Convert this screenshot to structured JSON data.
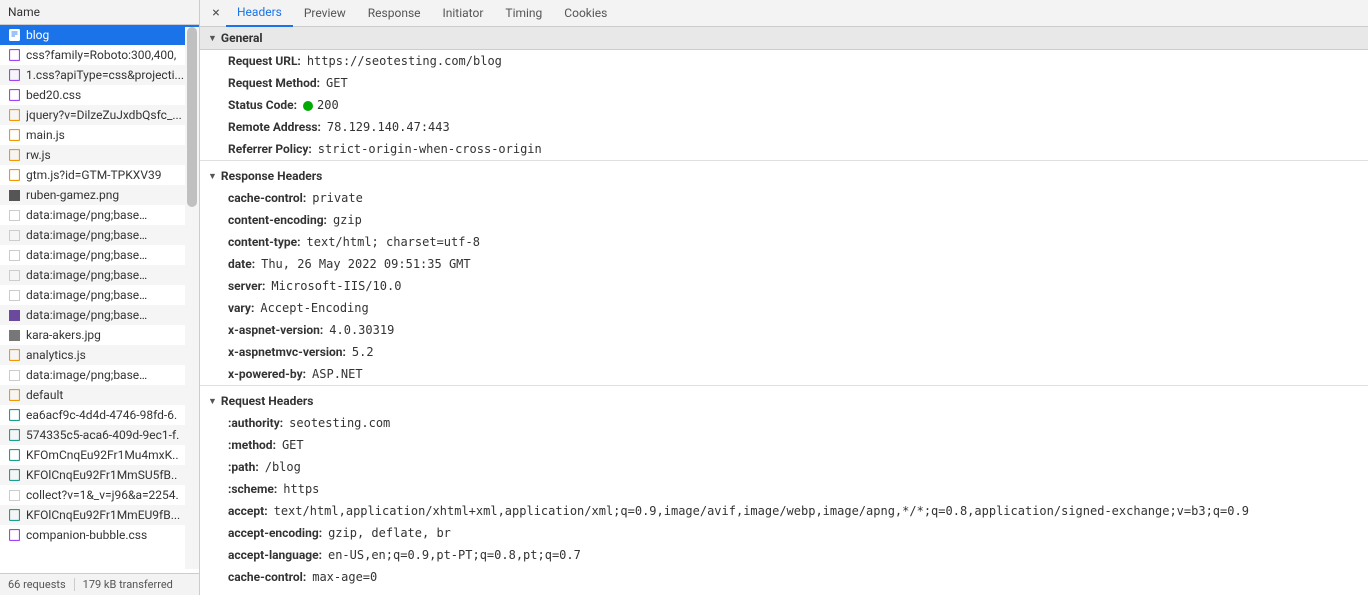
{
  "sidebar": {
    "header": "Name",
    "requests": [
      {
        "label": "blog",
        "iconColor": "#4285f4",
        "shape": "doc",
        "selected": true
      },
      {
        "label": "css?family=Roboto:300,400,",
        "iconColor": "#a142f4",
        "shape": "css"
      },
      {
        "label": "1.css?apiType=css&projecti...",
        "iconColor": "#a142f4",
        "shape": "css"
      },
      {
        "label": "bed20.css",
        "iconColor": "#a142f4",
        "shape": "css"
      },
      {
        "label": "jquery?v=DilzeZuJxdbQsfc_...",
        "iconColor": "#f29900",
        "shape": "js"
      },
      {
        "label": "main.js",
        "iconColor": "#f29900",
        "shape": "js"
      },
      {
        "label": "rw.js",
        "iconColor": "#f29900",
        "shape": "js"
      },
      {
        "label": "gtm.js?id=GTM-TPKXV39",
        "iconColor": "#f29900",
        "shape": "js"
      },
      {
        "label": "ruben-gamez.png",
        "iconColor": "#555",
        "shape": "img-dark"
      },
      {
        "label": "data:image/png;base…",
        "iconColor": "#ccc",
        "shape": "img"
      },
      {
        "label": "data:image/png;base…",
        "iconColor": "#ccc",
        "shape": "img"
      },
      {
        "label": "data:image/png;base…",
        "iconColor": "#ccc",
        "shape": "img"
      },
      {
        "label": "data:image/png;base…",
        "iconColor": "#ccc",
        "shape": "img"
      },
      {
        "label": "data:image/png;base…",
        "iconColor": "#ccc",
        "shape": "img"
      },
      {
        "label": "data:image/png;base…",
        "iconColor": "#6b4a9e",
        "shape": "img-dark"
      },
      {
        "label": "kara-akers.jpg",
        "iconColor": "#777",
        "shape": "img-dark"
      },
      {
        "label": "analytics.js",
        "iconColor": "#f29900",
        "shape": "js"
      },
      {
        "label": "data:image/png;base…",
        "iconColor": "#ccc",
        "shape": "img"
      },
      {
        "label": "default",
        "iconColor": "#f29900",
        "shape": "js"
      },
      {
        "label": "ea6acf9c-4d4d-4746-98fd-6.",
        "iconColor": "#1a9e8f",
        "shape": "font"
      },
      {
        "label": "574335c5-aca6-409d-9ec1-f.",
        "iconColor": "#1a9e8f",
        "shape": "font"
      },
      {
        "label": "KFOmCnqEu92Fr1Mu4mxK..",
        "iconColor": "#1a9e8f",
        "shape": "font"
      },
      {
        "label": "KFOlCnqEu92Fr1MmSU5fB..",
        "iconColor": "#1a9e8f",
        "shape": "font"
      },
      {
        "label": "collect?v=1&_v=j96&a=2254.",
        "iconColor": "#ccc",
        "shape": "img"
      },
      {
        "label": "KFOlCnqEu92Fr1MmEU9fB...",
        "iconColor": "#1a9e8f",
        "shape": "font"
      },
      {
        "label": "companion-bubble.css",
        "iconColor": "#a142f4",
        "shape": "css"
      }
    ],
    "footer": {
      "requests": "66 requests",
      "transferred": "179 kB transferred"
    }
  },
  "tabs": [
    "Headers",
    "Preview",
    "Response",
    "Initiator",
    "Timing",
    "Cookies"
  ],
  "activeTab": 0,
  "sections": {
    "general": {
      "title": "General",
      "rows": [
        {
          "key": "Request URL:",
          "val": "https://seotesting.com/blog"
        },
        {
          "key": "Request Method:",
          "val": "GET"
        },
        {
          "key": "Status Code:",
          "val": "200",
          "status": true
        },
        {
          "key": "Remote Address:",
          "val": "78.129.140.47:443"
        },
        {
          "key": "Referrer Policy:",
          "val": "strict-origin-when-cross-origin"
        }
      ]
    },
    "response": {
      "title": "Response Headers",
      "rows": [
        {
          "key": "cache-control:",
          "val": "private"
        },
        {
          "key": "content-encoding:",
          "val": "gzip"
        },
        {
          "key": "content-type:",
          "val": "text/html; charset=utf-8"
        },
        {
          "key": "date:",
          "val": "Thu, 26 May 2022 09:51:35 GMT"
        },
        {
          "key": "server:",
          "val": "Microsoft-IIS/10.0"
        },
        {
          "key": "vary:",
          "val": "Accept-Encoding"
        },
        {
          "key": "x-aspnet-version:",
          "val": "4.0.30319"
        },
        {
          "key": "x-aspnetmvc-version:",
          "val": "5.2"
        },
        {
          "key": "x-powered-by:",
          "val": "ASP.NET"
        }
      ]
    },
    "request": {
      "title": "Request Headers",
      "rows": [
        {
          "key": ":authority:",
          "val": "seotesting.com"
        },
        {
          "key": ":method:",
          "val": "GET"
        },
        {
          "key": ":path:",
          "val": "/blog"
        },
        {
          "key": ":scheme:",
          "val": "https"
        },
        {
          "key": "accept:",
          "val": "text/html,application/xhtml+xml,application/xml;q=0.9,image/avif,image/webp,image/apng,*/*;q=0.8,application/signed-exchange;v=b3;q=0.9"
        },
        {
          "key": "accept-encoding:",
          "val": "gzip, deflate, br"
        },
        {
          "key": "accept-language:",
          "val": "en-US,en;q=0.9,pt-PT;q=0.8,pt;q=0.7"
        },
        {
          "key": "cache-control:",
          "val": "max-age=0"
        }
      ]
    }
  }
}
